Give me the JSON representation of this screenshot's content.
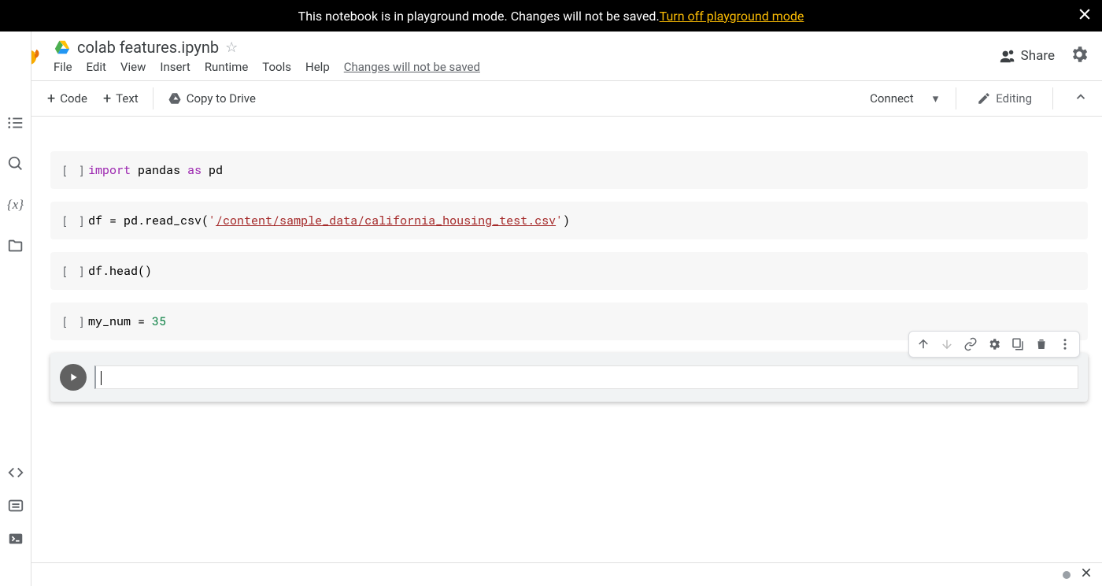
{
  "banner": {
    "text": "This notebook is in playground mode. Changes will not be saved. ",
    "link": "Turn off playground mode"
  },
  "header": {
    "title": "colab features.ipynb",
    "menu": [
      "File",
      "Edit",
      "View",
      "Insert",
      "Runtime",
      "Tools",
      "Help"
    ],
    "unsaved": "Changes will not be saved",
    "share": "Share"
  },
  "toolbar": {
    "code": "Code",
    "text": "Text",
    "copy_drive": "Copy to Drive",
    "connect": "Connect",
    "editing": "Editing"
  },
  "cells": [
    {
      "exec": "[ ]",
      "tokens": [
        {
          "t": "import ",
          "c": "kw"
        },
        {
          "t": "pandas ",
          "c": ""
        },
        {
          "t": "as ",
          "c": "kw"
        },
        {
          "t": "pd",
          "c": ""
        }
      ]
    },
    {
      "exec": "[ ]",
      "tokens": [
        {
          "t": "df = pd.read_csv(",
          "c": ""
        },
        {
          "t": "'",
          "c": "str-plain"
        },
        {
          "t": "/content/sample_data/california_housing_test.csv",
          "c": "str"
        },
        {
          "t": "'",
          "c": "str-plain"
        },
        {
          "t": ")",
          "c": ""
        }
      ]
    },
    {
      "exec": "[ ]",
      "tokens": [
        {
          "t": "df.head()",
          "c": ""
        }
      ]
    },
    {
      "exec": "[ ]",
      "tokens": [
        {
          "t": "my_num = ",
          "c": ""
        },
        {
          "t": "35",
          "c": "num"
        }
      ]
    }
  ],
  "active_cell": {
    "content": ""
  },
  "cell_toolbar_icons": [
    "move-up",
    "move-down",
    "link",
    "settings",
    "mirror",
    "delete",
    "more"
  ]
}
